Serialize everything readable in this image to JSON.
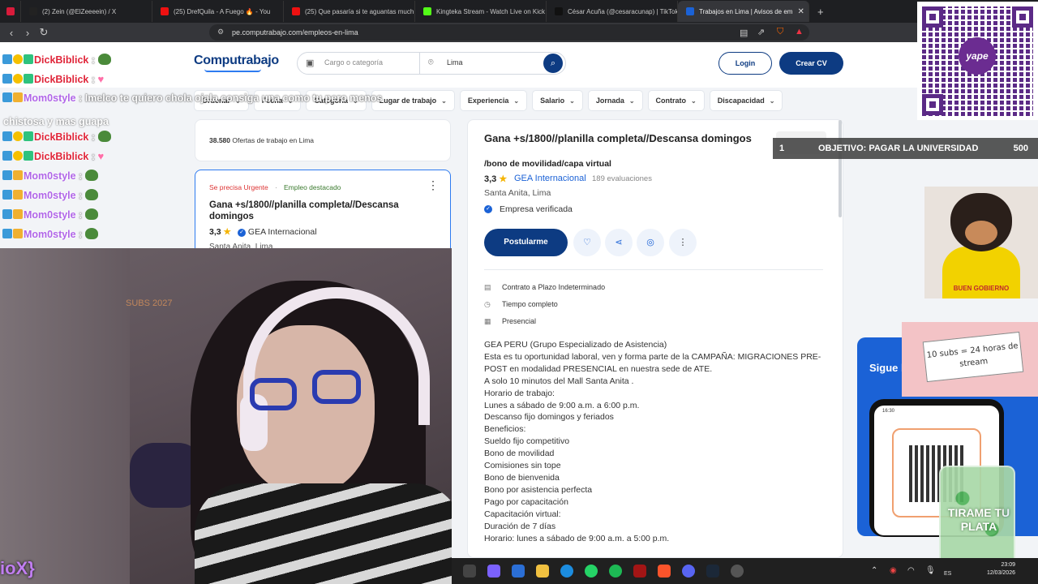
{
  "browser": {
    "tabs": [
      {
        "label": "",
        "color": "#d81b3b"
      },
      {
        "label": "(2) Zein (@ElZeeeein) / X",
        "color": "#222"
      },
      {
        "label": "(25) DrefQuila - A Fuego 🔥 - You",
        "color": "#e11"
      },
      {
        "label": "(25) Que pasaría si te aguantas much",
        "color": "#e11"
      },
      {
        "label": "Kingteka Stream - Watch Live on Kick",
        "color": "#53fc18"
      },
      {
        "label": "César Acuña (@cesaracunap) | TikTok",
        "color": "#111"
      },
      {
        "label": "Trabajos en Lima | Avisos de em",
        "color": "#1b62d6"
      }
    ],
    "url": "pe.computrabajo.com/empleos-en-lima"
  },
  "site": {
    "logo": "Computrabajo",
    "search_placeholder": "Cargo o categoría",
    "location_value": "Lima",
    "login": "Login",
    "create_cv": "Crear CV",
    "filters": [
      "Ordenar",
      "Fecha",
      "Categoría",
      "Lugar de trabajo",
      "Experiencia",
      "Salario",
      "Jornada",
      "Contrato",
      "Discapacidad"
    ],
    "offers_count": "38.580",
    "offers_text": "Ofertas de trabajo en Lima"
  },
  "job_card": {
    "urgent": "Se precisa Urgente",
    "separator": "·",
    "featured": "Empleo destacado",
    "title": "Gana +s/1800//planilla completa//Descansa domingos",
    "rating": "3,3",
    "company": "GEA Internacional",
    "location": "Santa Anita, Lima"
  },
  "detail": {
    "title": "Gana +s/1800//planilla completa//Descansa domingos",
    "subtitle": "/bono de movilidad/capa virtual",
    "rating": "3,3",
    "company": "GEA Internacional",
    "evaluations": "189 evaluaciones",
    "location": "Santa Anita, Lima",
    "verified": "Empresa verificada",
    "apply": "Postularme",
    "meta": [
      {
        "icon": "contract-icon",
        "text": "Contrato a Plazo Indeterminado"
      },
      {
        "icon": "clock-icon",
        "text": "Tiempo completo"
      },
      {
        "icon": "building-icon",
        "text": "Presencial"
      }
    ],
    "description": [
      "GEA PERU (Grupo Especializado de Asistencia)",
      "Esta es tu oportunidad laboral, ven y forma parte de la CAMPAÑA: MIGRACIONES PRE-POST en modalidad PRESENCIAL en nuestra sede de ATE.",
      "A solo 10 minutos del Mall Santa Anita .",
      "Horario de trabajo:",
      "Lunes a sábado de 9:00 a.m. a 6:00 p.m.",
      "Descanso fijo domingos y feriados",
      "Beneficios:",
      "Sueldo fijo competitivo",
      "Bono de movilidad",
      "Comisiones sin tope",
      "Bono de bienvenida",
      "Bono por asistencia perfecta",
      "Pago por capacitación",
      "Capacitación virtual:",
      "Duración de 7 días",
      "Horario: lunes a sábado de 9:00 a.m. a 5:00 p.m."
    ]
  },
  "promo": {
    "title": "Sigue l",
    "phone_time": "16:30"
  },
  "chat": [
    {
      "user": "DickBiblick",
      "color": "red",
      "msg": "",
      "emote": "frog"
    },
    {
      "user": "DickBiblick",
      "color": "red",
      "msg": "",
      "emote": "heart"
    },
    {
      "user": "Mom0style",
      "color": "purple",
      "msg": "Imelco te quiero chola ojala consiga una como tu pero menos",
      "emote": ""
    },
    {
      "user": "DickBiblick",
      "color": "red",
      "msg": "",
      "emote": "frog"
    },
    {
      "user": "DickBiblick",
      "color": "red",
      "msg": "",
      "emote": "heart"
    },
    {
      "user": "Mom0style",
      "color": "purple",
      "msg": "",
      "emote": "frog"
    },
    {
      "user": "Mom0style",
      "color": "purple",
      "msg": "",
      "emote": "frog"
    },
    {
      "user": "Mom0style",
      "color": "purple",
      "msg": "",
      "emote": "frog"
    },
    {
      "user": "Mom0style",
      "color": "purple",
      "msg": "",
      "emote": "frog"
    }
  ],
  "chat_wrap": "chistosa y mas guapa",
  "overlay": {
    "goal_number": "1",
    "goal_text": "OBJETIVO: PAGAR LA UNIVERSIDAD",
    "goal_value": "500",
    "dog_label": "BUEN GOBIERNO",
    "note": "10 subs = 24 horas de stream",
    "jar": "TIRAME TU PLATA",
    "yape": "yape",
    "nick": "ioX}",
    "webcam_label": "SUBS 2027"
  },
  "taskbar": {
    "time": "23:09",
    "date": "12/03/2026",
    "lang": "ES",
    "badge1": "63",
    "badge2": "99+"
  }
}
